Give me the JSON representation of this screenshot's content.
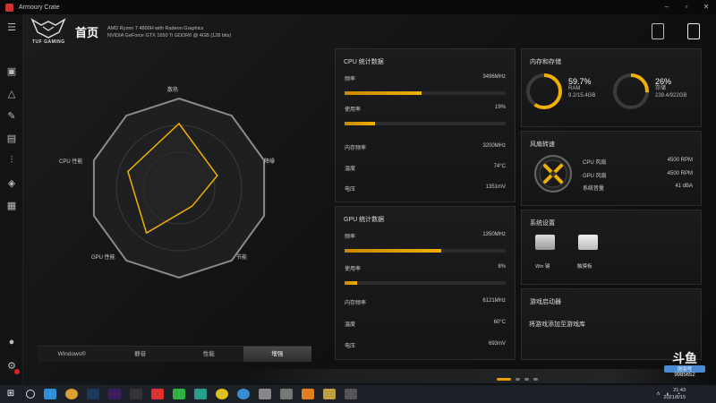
{
  "window": {
    "title": "Armoury Crate",
    "controls": [
      "–",
      "▫",
      "✕"
    ]
  },
  "sidebar": {
    "icons": [
      "menu-icon",
      "device-icon",
      "aura-icon",
      "armoury-icon",
      "scenario-icon",
      "settings-sliders-icon",
      "deals-icon",
      "news-icon",
      "user-icon",
      "gear-icon"
    ]
  },
  "header": {
    "brand": "TUF GAMING",
    "title": "首页",
    "cpu_info": "AMD Ryzen 7 4800H with Radeon Graphics",
    "gpu_info": "NVIDIA GeForce GTX 1650 Ti GDDR6 @ 4GB (128 bits)"
  },
  "radar": {
    "labels": {
      "top": "散热",
      "right": "降噪",
      "bottom_right": "节能",
      "bottom_left": "GPU 性能",
      "left": "CPU 性能"
    },
    "values": [
      0.72,
      0.45,
      0.25,
      0.62,
      0.6
    ]
  },
  "modes": {
    "items": [
      "Windows®",
      "静音",
      "性能",
      "增强"
    ],
    "active_index": 3
  },
  "cpu_panel": {
    "title": "CPU 统计数据",
    "freq_label": "频率",
    "freq_value": "3496MHz",
    "freq_fraction": 0.48,
    "usage_label": "使用率",
    "usage_value": "19%",
    "usage_fraction": 0.19,
    "mem_freq_label": "内存频率",
    "mem_freq_value": "3200MHz",
    "temp_label": "温度",
    "temp_value": "74°C",
    "voltage_label": "电压",
    "voltage_value": "1351mV"
  },
  "gpu_panel": {
    "title": "GPU 统计数据",
    "freq_label": "频率",
    "freq_value": "1350MHz",
    "freq_fraction": 0.6,
    "usage_label": "使用率",
    "usage_value": "8%",
    "usage_fraction": 0.08,
    "mem_freq_label": "内存频率",
    "mem_freq_value": "6121MHz",
    "temp_label": "温度",
    "temp_value": "60°C",
    "voltage_label": "电压",
    "voltage_value": "693mV"
  },
  "memory_panel": {
    "title": "内存和存储",
    "ram_pct": "59.7%",
    "ram_label": "RAM",
    "ram_detail": "9.2/15.4GB",
    "ram_fraction": 0.597,
    "storage_pct": "26%",
    "storage_label": "存储",
    "storage_detail": "239.4/922GB",
    "storage_fraction": 0.26
  },
  "fan_panel": {
    "title": "风扇转速",
    "cpu_fan_label": "CPU 风扇",
    "cpu_fan_value": "4500 RPM",
    "gpu_fan_label": "GPU 风扇",
    "gpu_fan_value": "4500 RPM",
    "noise_label": "系统音量",
    "noise_value": "41 dBA"
  },
  "settings_panel": {
    "title": "系统设置",
    "win_key": "Win 键",
    "touchpad": "触摸板"
  },
  "launcher_panel": {
    "title": "游戏启动器",
    "add_text": "将游戏添加至游戏库"
  },
  "watermark": {
    "logo": "斗鱼",
    "room": "房间号",
    "id": "9985652"
  },
  "taskbar": {
    "time": "21:43",
    "date": "2021/8/15"
  },
  "colors": {
    "accent": "#f0b000",
    "panel": "#1a1b1c"
  }
}
